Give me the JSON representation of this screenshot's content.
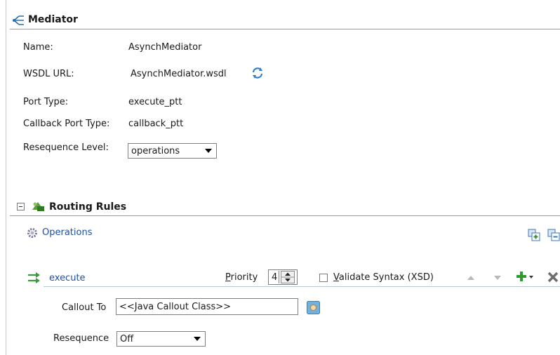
{
  "mediator": {
    "title": "Mediator",
    "name_label": "Name:",
    "name_value": "AsynchMediator",
    "wsdl_label": "WSDL URL:",
    "wsdl_value": "AsynchMediator.wsdl",
    "port_label": "Port Type:",
    "port_value": "execute_ptt",
    "callback_label": "Callback Port Type:",
    "callback_value": "callback_ptt",
    "reseq_level_label": "Resequence Level:",
    "reseq_level_value": "operations"
  },
  "routing": {
    "title": "Routing Rules",
    "operations_label": "Operations",
    "operation": {
      "name": "execute",
      "priority_label": "Priority",
      "priority_value": "4",
      "validate_label": "Validate Syntax (XSD)",
      "callout_label": "Callout To",
      "callout_value": "<<Java Callout Class>>",
      "resequence_label": "Resequence",
      "resequence_value": "Off"
    }
  },
  "icons": {
    "mediator": "mediator-icon",
    "refresh": "refresh-icon",
    "collapse": "collapse-icon",
    "routing": "routing-rules-icon",
    "operations": "gear-icon",
    "add_group": "add-group-icon",
    "collapse_group": "collapse-group-icon",
    "execute": "route-icon",
    "spinner": "spinner-arrows-icon",
    "move_up": "move-up-icon",
    "move_down": "move-down-icon",
    "add": "add-icon",
    "delete": "delete-icon",
    "browse": "browse-icon"
  }
}
